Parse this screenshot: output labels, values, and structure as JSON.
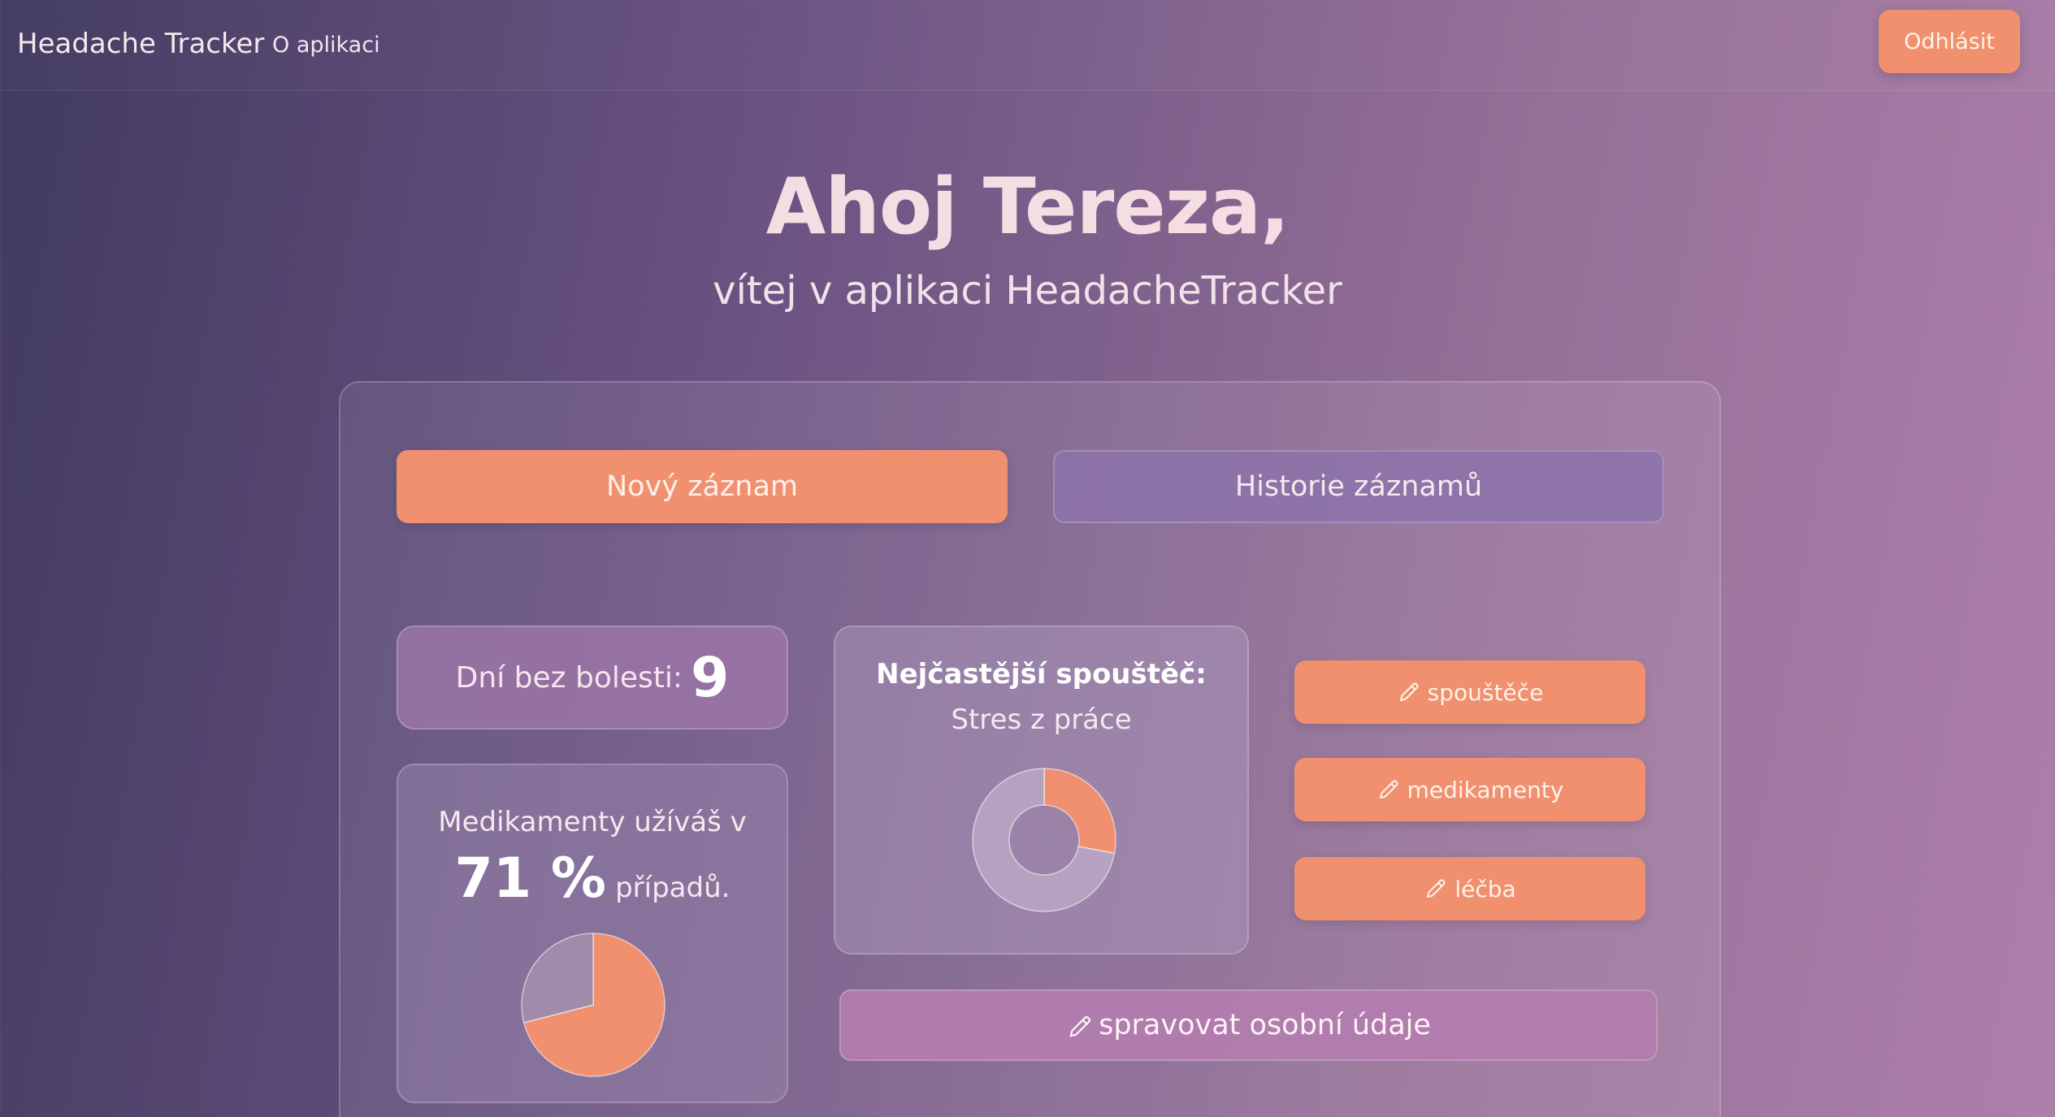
{
  "navbar": {
    "brand": "Headache Tracker",
    "about_link": "O aplikaci",
    "logout_label": "Odhlásit"
  },
  "hero": {
    "greeting": "Ahoj Tereza,",
    "subtitle": "vítej v aplikaci HeadacheTracker"
  },
  "actions": {
    "new_record": "Nový záznam",
    "history": "Historie záznamů"
  },
  "stats": {
    "days_label": "Dní bez bolesti:",
    "days_value": "9",
    "meds_line": "Medikamenty užíváš v",
    "meds_percent": "71 %",
    "meds_suffix": "případů.",
    "meds_fraction": 0.71,
    "trigger_title": "Nejčastější spouštěč:",
    "trigger_value": "Stres z práce",
    "trigger_fraction": 0.28
  },
  "edit_buttons": {
    "triggers": "spouštěče",
    "medications": "medikamenty",
    "therapy": "léčba",
    "personal": "spravovat osobní údaje"
  },
  "colors": {
    "accent": "#f0906e",
    "pie_rest": "#a08bab",
    "donut_rest": "#b5a2c0"
  },
  "icons": {
    "edit": "pencil-icon"
  }
}
